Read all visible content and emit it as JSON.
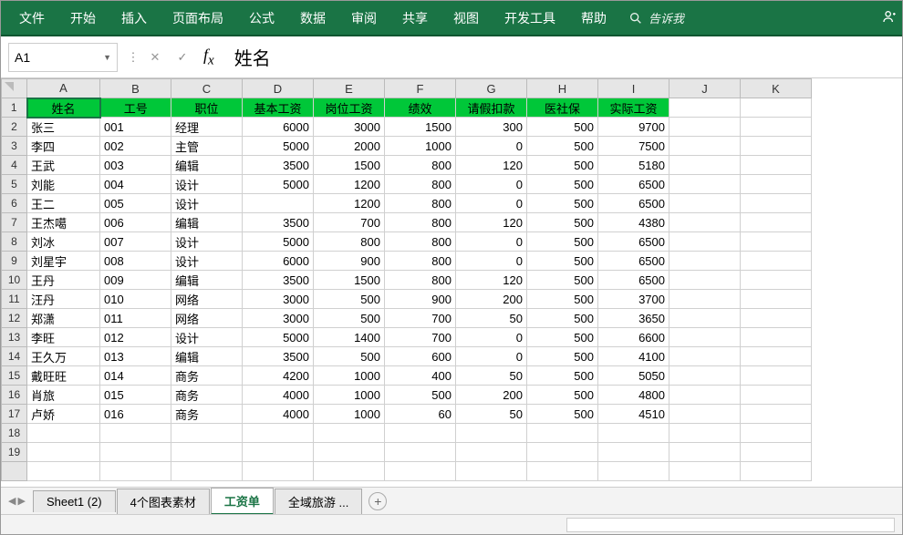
{
  "ribbon": {
    "tabs": [
      "文件",
      "开始",
      "插入",
      "页面布局",
      "公式",
      "数据",
      "审阅",
      "共享",
      "视图",
      "开发工具",
      "帮助"
    ],
    "tell": "告诉我"
  },
  "namebox": "A1",
  "formula_value": "姓名",
  "columns": [
    "A",
    "B",
    "C",
    "D",
    "E",
    "F",
    "G",
    "H",
    "I",
    "J",
    "K"
  ],
  "headers": [
    "姓名",
    "工号",
    "职位",
    "基本工资",
    "岗位工资",
    "绩效",
    "请假扣款",
    "医社保",
    "实际工资"
  ],
  "rows": [
    [
      "张三",
      "001",
      "经理",
      "6000",
      "3000",
      "1500",
      "300",
      "500",
      "9700"
    ],
    [
      "李四",
      "002",
      "主管",
      "5000",
      "2000",
      "1000",
      "0",
      "500",
      "7500"
    ],
    [
      "王武",
      "003",
      "编辑",
      "3500",
      "1500",
      "800",
      "120",
      "500",
      "5180"
    ],
    [
      "刘能",
      "004",
      "设计",
      "5000",
      "1200",
      "800",
      "0",
      "500",
      "6500"
    ],
    [
      "王二",
      "005",
      "设计",
      "",
      "1200",
      "800",
      "0",
      "500",
      "6500"
    ],
    [
      "王杰噶",
      "006",
      "编辑",
      "3500",
      "700",
      "800",
      "120",
      "500",
      "4380"
    ],
    [
      "刘冰",
      "007",
      "设计",
      "5000",
      "800",
      "800",
      "0",
      "500",
      "6500"
    ],
    [
      "刘星宇",
      "008",
      "设计",
      "6000",
      "900",
      "800",
      "0",
      "500",
      "6500"
    ],
    [
      "王丹",
      "009",
      "编辑",
      "3500",
      "1500",
      "800",
      "120",
      "500",
      "6500"
    ],
    [
      "汪丹",
      "010",
      "网络",
      "3000",
      "500",
      "900",
      "200",
      "500",
      "3700"
    ],
    [
      "郑潇",
      "011",
      "网络",
      "3000",
      "500",
      "700",
      "50",
      "500",
      "3650"
    ],
    [
      "李旺",
      "012",
      "设计",
      "5000",
      "1400",
      "700",
      "0",
      "500",
      "6600"
    ],
    [
      "王久万",
      "013",
      "编辑",
      "3500",
      "500",
      "600",
      "0",
      "500",
      "4100"
    ],
    [
      "戴旺旺",
      "014",
      "商务",
      "4200",
      "1000",
      "400",
      "50",
      "500",
      "5050"
    ],
    [
      "肖旅",
      "015",
      "商务",
      "4000",
      "1000",
      "500",
      "200",
      "500",
      "4800"
    ],
    [
      "卢娇",
      "016",
      "商务",
      "4000",
      "1000",
      "60",
      "50",
      "500",
      "4510"
    ]
  ],
  "sheets": [
    "Sheet1 (2)",
    "4个图表素材",
    "工资单",
    "全域旅游 ..."
  ],
  "active_sheet": 2,
  "chart_data": {
    "type": "table",
    "title": "工资单",
    "columns": [
      "姓名",
      "工号",
      "职位",
      "基本工资",
      "岗位工资",
      "绩效",
      "请假扣款",
      "医社保",
      "实际工资"
    ],
    "records": [
      {
        "姓名": "张三",
        "工号": "001",
        "职位": "经理",
        "基本工资": 6000,
        "岗位工资": 3000,
        "绩效": 1500,
        "请假扣款": 300,
        "医社保": 500,
        "实际工资": 9700
      },
      {
        "姓名": "李四",
        "工号": "002",
        "职位": "主管",
        "基本工资": 5000,
        "岗位工资": 2000,
        "绩效": 1000,
        "请假扣款": 0,
        "医社保": 500,
        "实际工资": 7500
      },
      {
        "姓名": "王武",
        "工号": "003",
        "职位": "编辑",
        "基本工资": 3500,
        "岗位工资": 1500,
        "绩效": 800,
        "请假扣款": 120,
        "医社保": 500,
        "实际工资": 5180
      },
      {
        "姓名": "刘能",
        "工号": "004",
        "职位": "设计",
        "基本工资": 5000,
        "岗位工资": 1200,
        "绩效": 800,
        "请假扣款": 0,
        "医社保": 500,
        "实际工资": 6500
      },
      {
        "姓名": "王二",
        "工号": "005",
        "职位": "设计",
        "基本工资": null,
        "岗位工资": 1200,
        "绩效": 800,
        "请假扣款": 0,
        "医社保": 500,
        "实际工资": 6500
      },
      {
        "姓名": "王杰噶",
        "工号": "006",
        "职位": "编辑",
        "基本工资": 3500,
        "岗位工资": 700,
        "绩效": 800,
        "请假扣款": 120,
        "医社保": 500,
        "实际工资": 4380
      },
      {
        "姓名": "刘冰",
        "工号": "007",
        "职位": "设计",
        "基本工资": 5000,
        "岗位工资": 800,
        "绩效": 800,
        "请假扣款": 0,
        "医社保": 500,
        "实际工资": 6500
      },
      {
        "姓名": "刘星宇",
        "工号": "008",
        "职位": "设计",
        "基本工资": 6000,
        "岗位工资": 900,
        "绩效": 800,
        "请假扣款": 0,
        "医社保": 500,
        "实际工资": 6500
      },
      {
        "姓名": "王丹",
        "工号": "009",
        "职位": "编辑",
        "基本工资": 3500,
        "岗位工资": 1500,
        "绩效": 800,
        "请假扣款": 120,
        "医社保": 500,
        "实际工资": 6500
      },
      {
        "姓名": "汪丹",
        "工号": "010",
        "职位": "网络",
        "基本工资": 3000,
        "岗位工资": 500,
        "绩效": 900,
        "请假扣款": 200,
        "医社保": 500,
        "实际工资": 3700
      },
      {
        "姓名": "郑潇",
        "工号": "011",
        "职位": "网络",
        "基本工资": 3000,
        "岗位工资": 500,
        "绩效": 700,
        "请假扣款": 50,
        "医社保": 500,
        "实际工资": 3650
      },
      {
        "姓名": "李旺",
        "工号": "012",
        "职位": "设计",
        "基本工资": 5000,
        "岗位工资": 1400,
        "绩效": 700,
        "请假扣款": 0,
        "医社保": 500,
        "实际工资": 6600
      },
      {
        "姓名": "王久万",
        "工号": "013",
        "职位": "编辑",
        "基本工资": 3500,
        "岗位工资": 500,
        "绩效": 600,
        "请假扣款": 0,
        "医社保": 500,
        "实际工资": 4100
      },
      {
        "姓名": "戴旺旺",
        "工号": "014",
        "职位": "商务",
        "基本工资": 4200,
        "岗位工资": 1000,
        "绩效": 400,
        "请假扣款": 50,
        "医社保": 500,
        "实际工资": 5050
      },
      {
        "姓名": "肖旅",
        "工号": "015",
        "职位": "商务",
        "基本工资": 4000,
        "岗位工资": 1000,
        "绩效": 500,
        "请假扣款": 200,
        "医社保": 500,
        "实际工资": 4800
      },
      {
        "姓名": "卢娇",
        "工号": "016",
        "职位": "商务",
        "基本工资": 4000,
        "岗位工资": 1000,
        "绩效": 60,
        "请假扣款": 50,
        "医社保": 500,
        "实际工资": 4510
      }
    ]
  }
}
